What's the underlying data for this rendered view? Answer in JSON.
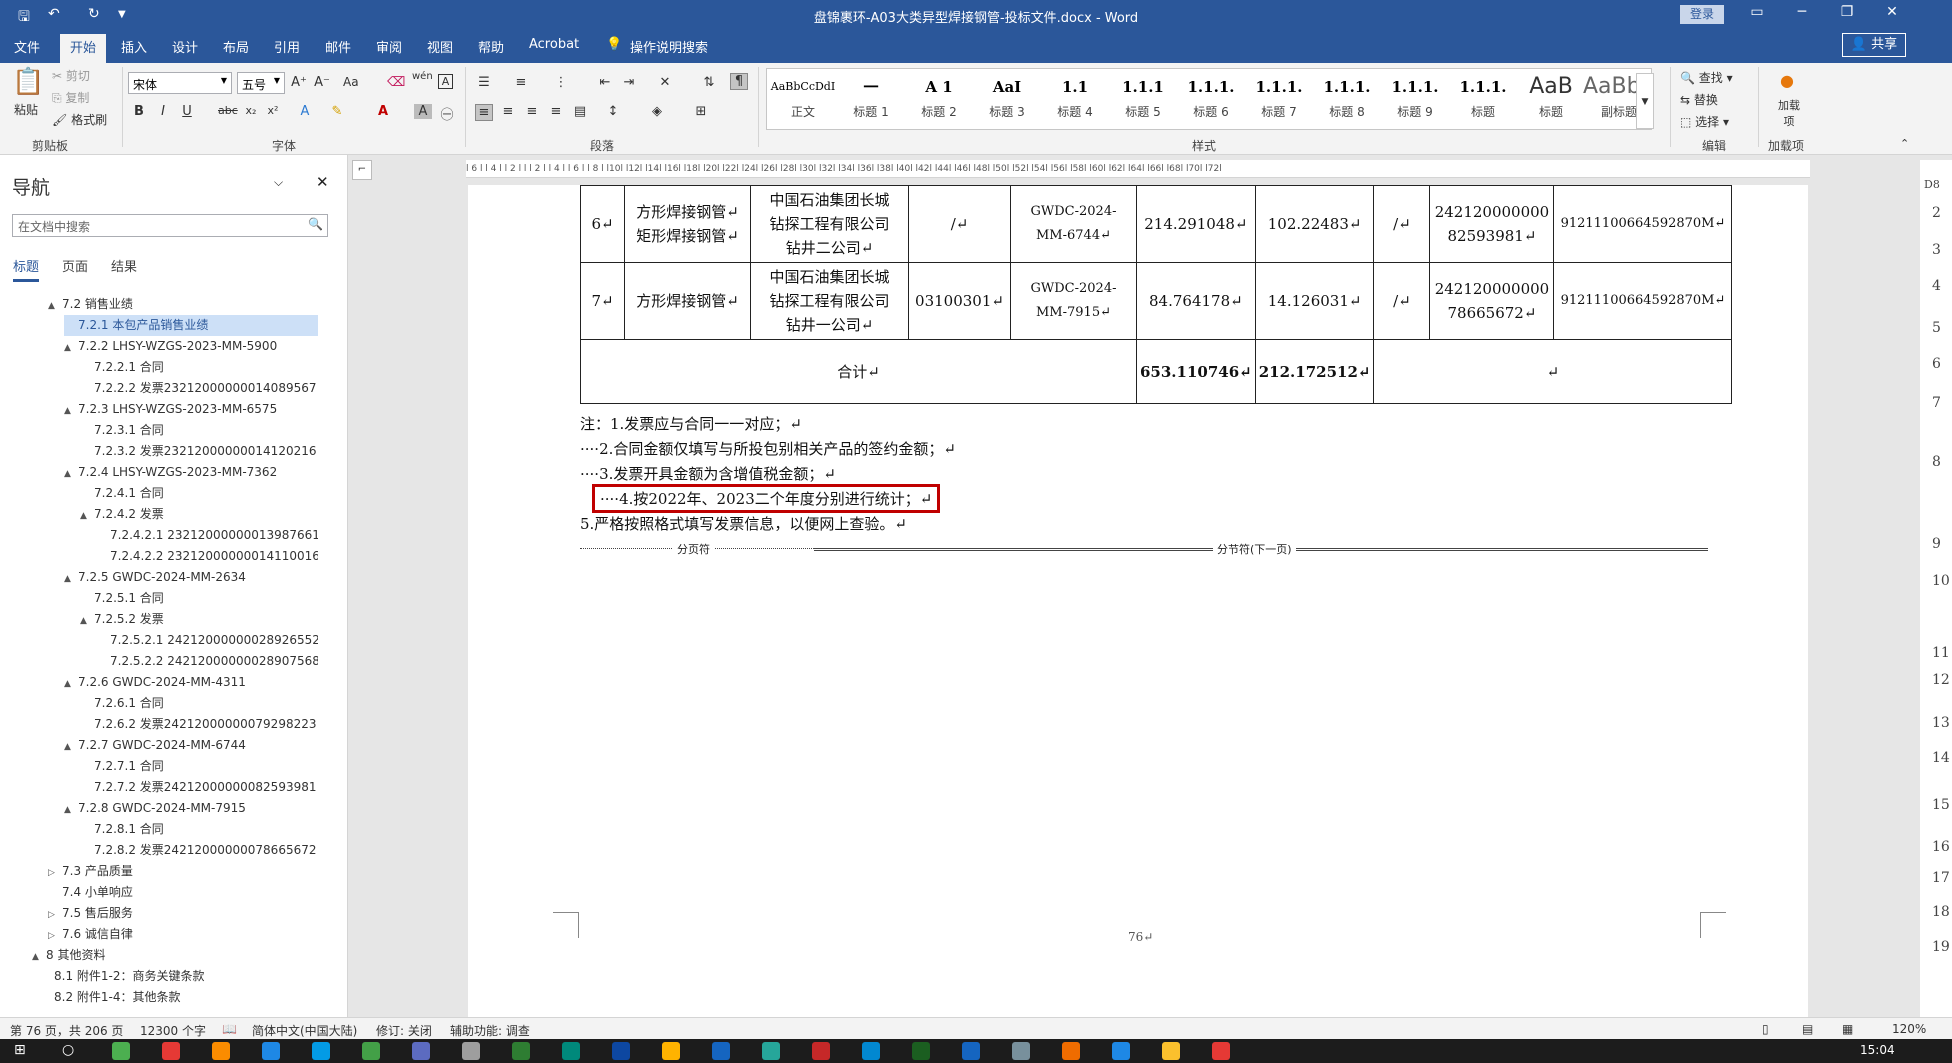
{
  "window": {
    "title": "盘锦裹环-A03大类异型焊接钢管-投标文件.docx - Word",
    "login": "登录",
    "wc_icons": [
      "▭",
      "─",
      "❐",
      "✕"
    ]
  },
  "tabs": [
    "文件",
    "开始",
    "插入",
    "设计",
    "布局",
    "引用",
    "邮件",
    "审阅",
    "视图",
    "帮助",
    "Acrobat",
    "操作说明搜索"
  ],
  "share": "共享",
  "ribbon": {
    "clipboard": {
      "label": "剪贴板",
      "paste": "粘贴",
      "cut": "剪切",
      "copy": "复制",
      "format_painter": "格式刷"
    },
    "font": {
      "label": "字体",
      "name": "宋体",
      "size": "五号",
      "aa": "Aa",
      "wen": "wén"
    },
    "paragraph": {
      "label": "段落"
    },
    "styles": {
      "label": "样式",
      "items": [
        {
          "preview": "AaBbCcDdI",
          "name": "正文"
        },
        {
          "preview": "一",
          "name": "标题 1"
        },
        {
          "preview": "A 1",
          "name": "标题 2"
        },
        {
          "preview": "AaI",
          "name": "标题 3"
        },
        {
          "preview": "1.1",
          "name": "标题 4"
        },
        {
          "preview": "1.1.1",
          "name": "标题 5"
        },
        {
          "preview": "1.1.1.",
          "name": "标题 6"
        },
        {
          "preview": "1.1.1.",
          "name": "标题 7"
        },
        {
          "preview": "1.1.1.",
          "name": "标题 8"
        },
        {
          "preview": "1.1.1.",
          "name": "标题 9"
        },
        {
          "preview": "1.1.1.",
          "name": "标题"
        },
        {
          "preview": "AaB",
          "name": "标题"
        },
        {
          "preview": "AaBbC",
          "name": "副标题"
        }
      ]
    },
    "editing": {
      "label": "编辑",
      "find": "查找",
      "replace": "替换",
      "select": "选择"
    },
    "addins": {
      "label": "加载项",
      "btn": "加载项"
    }
  },
  "nav": {
    "title": "导航",
    "search_placeholder": "在文档中搜索",
    "tabs": [
      "标题",
      "页面",
      "结果"
    ],
    "items": [
      {
        "t": "7.2 销售业绩",
        "lvl": 0,
        "c": "▲"
      },
      {
        "t": "7.2.1 本包产品销售业绩",
        "lvl": 1,
        "c": "",
        "sel": true
      },
      {
        "t": "7.2.2 LHSY-WZGS-2023-MM-5900",
        "lvl": 1,
        "c": "▲"
      },
      {
        "t": "7.2.2.1 合同",
        "lvl": 2,
        "c": ""
      },
      {
        "t": "7.2.2.2 发票23212000000014089567",
        "lvl": 2,
        "c": ""
      },
      {
        "t": "7.2.3 LHSY-WZGS-2023-MM-6575",
        "lvl": 1,
        "c": "▲"
      },
      {
        "t": "7.2.3.1 合同",
        "lvl": 2,
        "c": ""
      },
      {
        "t": "7.2.3.2 发票23212000000014120216",
        "lvl": 2,
        "c": ""
      },
      {
        "t": "7.2.4 LHSY-WZGS-2023-MM-7362",
        "lvl": 1,
        "c": "▲"
      },
      {
        "t": "7.2.4.1 合同",
        "lvl": 2,
        "c": ""
      },
      {
        "t": "7.2.4.2 发票",
        "lvl": 2,
        "c": "▲"
      },
      {
        "t": "7.2.4.2.1 23212000000013987661",
        "lvl": 3,
        "c": ""
      },
      {
        "t": "7.2.4.2.2 23212000000014110016",
        "lvl": 3,
        "c": ""
      },
      {
        "t": "7.2.5 GWDC-2024-MM-2634",
        "lvl": 1,
        "c": "▲"
      },
      {
        "t": "7.2.5.1 合同",
        "lvl": 2,
        "c": ""
      },
      {
        "t": "7.2.5.2 发票",
        "lvl": 2,
        "c": "▲"
      },
      {
        "t": "7.2.5.2.1 24212000000028926552",
        "lvl": 3,
        "c": ""
      },
      {
        "t": "7.2.5.2.2 24212000000028907568...",
        "lvl": 3,
        "c": ""
      },
      {
        "t": "7.2.6 GWDC-2024-MM-4311",
        "lvl": 1,
        "c": "▲"
      },
      {
        "t": "7.2.6.1 合同",
        "lvl": 2,
        "c": ""
      },
      {
        "t": "7.2.6.2 发票24212000000079298223",
        "lvl": 2,
        "c": ""
      },
      {
        "t": "7.2.7 GWDC-2024-MM-6744",
        "lvl": 1,
        "c": "▲"
      },
      {
        "t": "7.2.7.1 合同",
        "lvl": 2,
        "c": ""
      },
      {
        "t": "7.2.7.2 发票24212000000082593981",
        "lvl": 2,
        "c": ""
      },
      {
        "t": "7.2.8 GWDC-2024-MM-7915",
        "lvl": 1,
        "c": "▲"
      },
      {
        "t": "7.2.8.1 合同",
        "lvl": 2,
        "c": ""
      },
      {
        "t": "7.2.8.2 发票24212000000078665672",
        "lvl": 2,
        "c": ""
      },
      {
        "t": "7.3 产品质量",
        "lvl": 0,
        "c": "▷"
      },
      {
        "t": "7.4 小单响应",
        "lvl": 0,
        "c": ""
      },
      {
        "t": "7.5 售后服务",
        "lvl": 0,
        "c": "▷"
      },
      {
        "t": "7.6 诚信自律",
        "lvl": 0,
        "c": "▷"
      },
      {
        "t": "8 其他资料",
        "lvl": -1,
        "c": "▲"
      },
      {
        "t": "8.1 附件1-2：商务关键条款",
        "lvl": -0.5,
        "c": ""
      },
      {
        "t": "8.2 附件1-4：其他条款",
        "lvl": -0.5,
        "c": ""
      }
    ]
  },
  "table": {
    "rows": [
      [
        "6↵",
        "方形焊接钢管↵\n矩形焊接钢管↵",
        "中国石油集团长城\n钻探工程有限公司\n钻井二公司↵",
        "/↵",
        "GWDC-2024-\nMM-6744↵",
        "214.291048↵",
        "102.22483↵",
        "/↵",
        "242120000000\n82593981↵",
        "91211100664592870M↵"
      ],
      [
        "7↵",
        "方形焊接钢管↵",
        "中国石油集团长城\n钻探工程有限公司\n钻井一公司↵",
        "03100301↵",
        "GWDC-2024-\nMM-7915↵",
        "84.764178↵",
        "14.126031↵",
        "/↵",
        "242120000000\n78665672↵",
        "91211100664592870M↵"
      ]
    ],
    "total_label": "合计↵",
    "total_a": "653.110746↵",
    "total_b": "212.172512↵",
    "total_rest": "↵"
  },
  "notes": [
    "注：1.发票应与合同一一对应；↵",
    "····2.合同金额仅填写与所投包别相关产品的签约金额；↵",
    "····3.发票开具金额为含增值税金额；↵",
    "····4.按2022年、2023二个年度分别进行统计；↵",
    "    5.严格按照格式填写发票信息，以便网上查验。↵"
  ],
  "page_break": "分页符",
  "section_break": "分节符(下一页)",
  "page_number": "76↵",
  "ruler_marks": "l 6 l  l 4 l  l 2 l  l    l 2 l  l 4 l  l 6 l  l 8 l  l10l  l12l  l14l  l16l  l18l  l20l  l22l  l24l  l26l  l28l  l30l  l32l  l34l  l36l  l38l  l40l  l42l  l44l  l46l  l48l  l50l  l52l  l54l  l56l  l58l  l60l  l62l  l64l  l66l  l68l  l70l  l72l",
  "vruler": [
    "D8",
    "2",
    "3",
    "4",
    "5",
    "6",
    "7",
    "8",
    "9",
    "10",
    "11",
    "12",
    "13",
    "14",
    "15",
    "16",
    "17",
    "18",
    "19"
  ],
  "status": {
    "page": "第 76 页，共 206 页",
    "words": "12300 个字",
    "lang": "简体中文(中国大陆)",
    "track": "修订: 关闭",
    "access": "辅助功能: 调查",
    "zoom": "120%"
  },
  "clock": "15:04",
  "colors": {
    "accent": "#2b579a",
    "highlight": "#c00000"
  }
}
